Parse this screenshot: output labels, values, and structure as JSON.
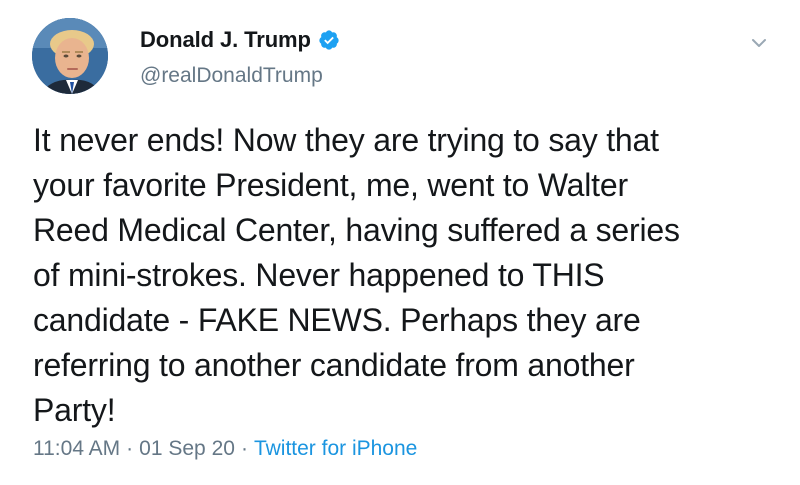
{
  "author": {
    "display_name": "Donald J. Trump",
    "handle": "@realDonaldTrump",
    "verified": true,
    "avatar_icon": "profile-photo"
  },
  "tweet": {
    "text": "It never ends! Now they are trying to say that\nyour favorite President, me, went to Walter\nReed Medical Center, having suffered a series\nof mini-strokes. Never happened to THIS\ncandidate - FAKE NEWS. Perhaps they are\nreferring to another candidate from another\nParty!",
    "time": "11:04 AM",
    "separator": "·",
    "date": "01 Sep 20",
    "source": "Twitter for iPhone"
  },
  "icons": {
    "verified": "verified-badge-icon",
    "menu": "chevron-down-icon"
  },
  "colors": {
    "link": "#1b95e0",
    "verified": "#1da1f2",
    "secondary_text": "#657786",
    "primary_text": "#14171a"
  }
}
